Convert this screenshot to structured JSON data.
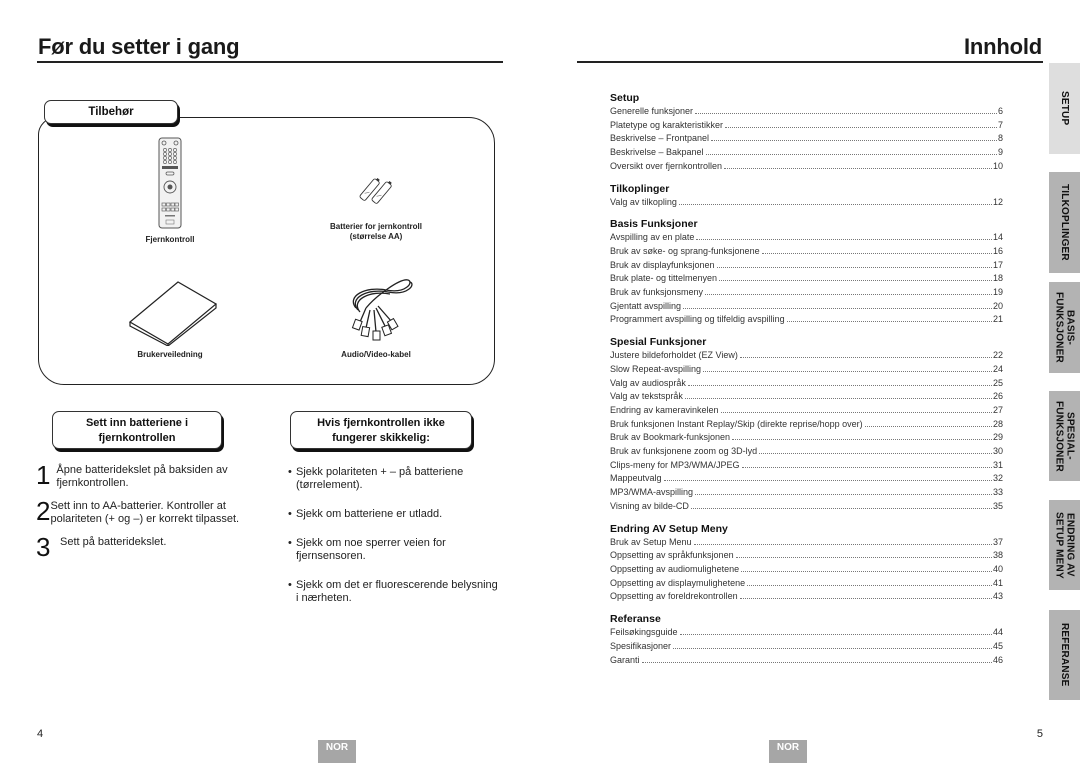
{
  "left_page": {
    "title": "Før du setter i gang",
    "accessories": {
      "heading": "Tilbehør",
      "items": [
        {
          "icon": "remote-control-icon",
          "label": "Fjernkontroll"
        },
        {
          "icon": "batteries-icon",
          "label_line1": "Batterier for jernkontroll",
          "label_line2": "(størrelse AA)"
        },
        {
          "icon": "user-manual-icon",
          "label": "Brukerveiledning"
        },
        {
          "icon": "av-cable-icon",
          "label": "Audio/Video-kabel"
        }
      ]
    },
    "insert_batteries": {
      "heading_line1": "Sett inn batteriene i",
      "heading_line2": "fjernkontrollen",
      "steps": [
        {
          "num": "1",
          "text": "Åpne batteridekslet på baksiden av fjernkontrollen."
        },
        {
          "num": "2",
          "text": "Sett inn to AA-batterier. Kontroller at polariteten (+ og –) er korrekt tilpasset."
        },
        {
          "num": "3",
          "text": "Sett på batteridekslet."
        }
      ]
    },
    "troubleshoot": {
      "heading_line1": "Hvis fjernkontrollen ikke",
      "heading_line2": "fungerer skikkelig:",
      "bullet": "•",
      "items": [
        "Sjekk polariteten + – på batteriene (tørrelement).",
        "Sjekk om batteriene er utladd.",
        "Sjekk om noe sperrer veien for fjernsensoren.",
        "Sjekk om det er fluorescerende belysning i nærheten."
      ]
    },
    "page_number": "4",
    "language_badge": "NOR"
  },
  "right_page": {
    "title": "Innhold",
    "toc": [
      {
        "heading": "Setup",
        "entries": [
          {
            "label": "Generelle funksjoner",
            "page": "6"
          },
          {
            "label": "Platetype og karakteristikker",
            "page": "7"
          },
          {
            "label": "Beskrivelse – Frontpanel",
            "page": "8"
          },
          {
            "label": "Beskrivelse – Bakpanel",
            "page": "9"
          },
          {
            "label": "Oversikt over fjernkontrollen",
            "page": "10"
          }
        ]
      },
      {
        "heading": "Tilkoplinger",
        "entries": [
          {
            "label": "Valg av tilkopling",
            "page": "12"
          }
        ]
      },
      {
        "heading": "Basis Funksjoner",
        "entries": [
          {
            "label": "Avspilling av en plate",
            "page": "14"
          },
          {
            "label": "Bruk av søke- og sprang-funksjonene",
            "page": "16"
          },
          {
            "label": "Bruk av displayfunksjonen",
            "page": "17"
          },
          {
            "label": "Bruk plate- og tittelmenyen",
            "page": "18"
          },
          {
            "label": "Bruk av funksjonsmeny",
            "page": "19"
          },
          {
            "label": "Gjentatt avspilling",
            "page": "20"
          },
          {
            "label": "Programmert avspilling og tilfeldig avspilling",
            "page": "21"
          }
        ]
      },
      {
        "heading": "Spesial Funksjoner",
        "entries": [
          {
            "label": "Justere bildeforholdet (EZ View)",
            "page": "22"
          },
          {
            "label": "Slow Repeat-avspilling",
            "page": "24"
          },
          {
            "label": "Valg av audiospråk",
            "page": "25"
          },
          {
            "label": "Valg av tekstspråk",
            "page": "26"
          },
          {
            "label": "Endring av kameravinkelen",
            "page": "27"
          },
          {
            "label": "Bruk funksjonen Instant Replay/Skip (direkte reprise/hopp over)",
            "page": "28"
          },
          {
            "label": "Bruk av Bookmark-funksjonen",
            "page": "29"
          },
          {
            "label": "Bruk av funksjonene zoom og 3D-lyd",
            "page": "30"
          },
          {
            "label": "Clips-meny for MP3/WMA/JPEG",
            "page": "31"
          },
          {
            "label": "Mappeutvalg",
            "page": "32"
          },
          {
            "label": "MP3/WMA-avspilling",
            "page": "33"
          },
          {
            "label": "Visning av bilde-CD",
            "page": "35"
          }
        ]
      },
      {
        "heading": "Endring AV Setup Meny",
        "entries": [
          {
            "label": "Bruk av Setup Menu",
            "page": "37"
          },
          {
            "label": "Oppsetting av språkfunksjonen",
            "page": "38"
          },
          {
            "label": "Oppsetting av audiomulighetene",
            "page": "40"
          },
          {
            "label": "Oppsetting av displaymulighetene",
            "page": "41"
          },
          {
            "label": "Oppsetting av foreldrekontrollen",
            "page": "43"
          }
        ]
      },
      {
        "heading": "Referanse",
        "entries": [
          {
            "label": "Feilsøkingsguide",
            "page": "44"
          },
          {
            "label": "Spesifikasjoner",
            "page": "45"
          },
          {
            "label": "Garanti",
            "page": "46"
          }
        ]
      }
    ],
    "side_tabs": [
      {
        "label": "SETUP",
        "active": true
      },
      {
        "label": "TILKOPLINGER",
        "active": false
      },
      {
        "label": "BASIS-\nFUNKSJONER",
        "active": false
      },
      {
        "label": "SPESIAL-\nFUNKSJONER",
        "active": false
      },
      {
        "label": "ENDRING AV\nSETUP MENY",
        "active": false
      },
      {
        "label": "REFERANSE",
        "active": false
      }
    ],
    "page_number": "5",
    "language_badge": "NOR"
  },
  "colors": {
    "text": "#1a1a1a",
    "tab_active": "#dedede",
    "tab_inactive": "#b3b3b3",
    "badge": "#a6a6a6"
  }
}
